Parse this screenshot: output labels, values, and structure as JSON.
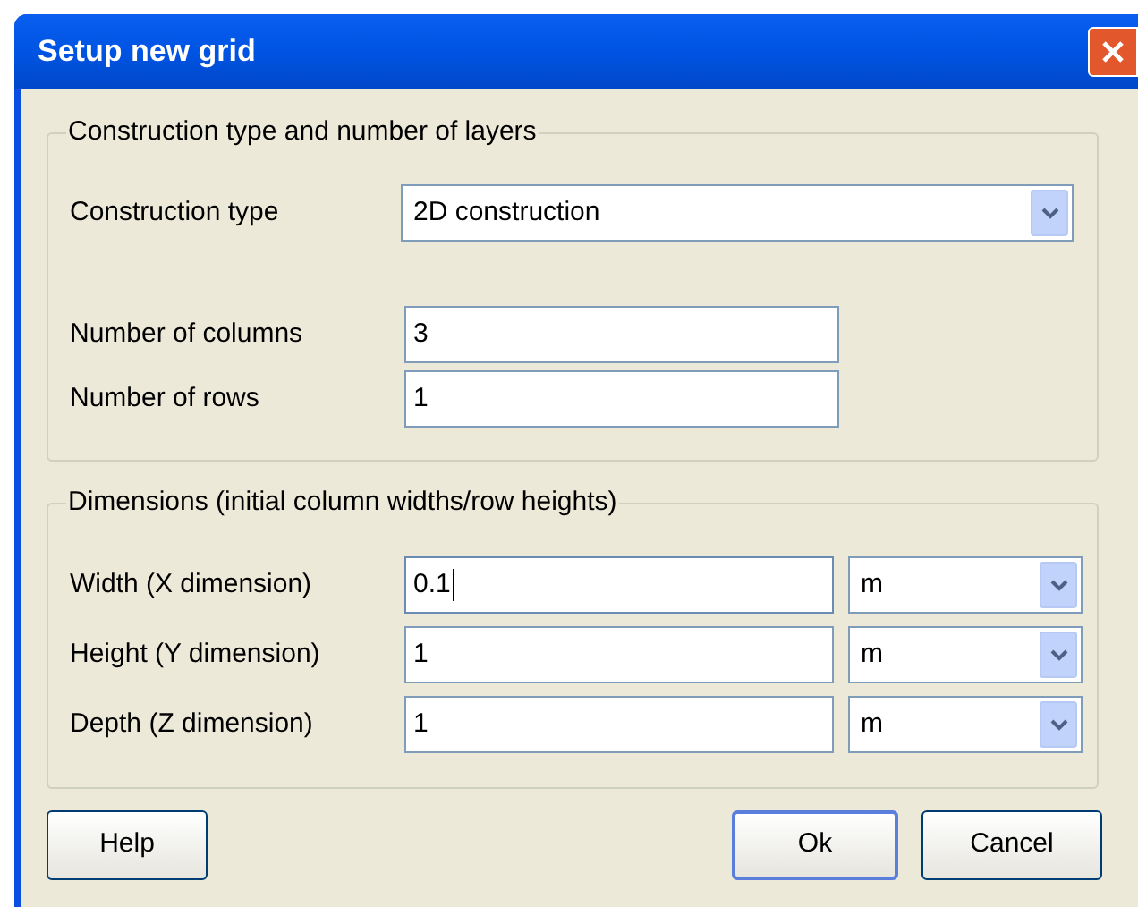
{
  "window": {
    "title": "Setup new grid"
  },
  "construction_group": {
    "legend": "Construction type and number of layers",
    "construction_type": {
      "label": "Construction type",
      "value": "2D construction"
    },
    "fields": [
      {
        "label": "Number of columns",
        "value": "3"
      },
      {
        "label": "Number of rows",
        "value": "1"
      }
    ]
  },
  "dimensions_group": {
    "legend": "Dimensions (initial column widths/row heights)",
    "rows": [
      {
        "label": "Width (X dimension)",
        "value": "0.1",
        "focused": true,
        "unit": "m"
      },
      {
        "label": "Height (Y dimension)",
        "value": "1",
        "focused": false,
        "unit": "m"
      },
      {
        "label": "Depth (Z dimension)",
        "value": "1",
        "focused": false,
        "unit": "m"
      }
    ]
  },
  "buttons": [
    {
      "label": "Help",
      "kind": "secondary",
      "default": false
    },
    {
      "label": "Ok",
      "kind": "primary",
      "default": true
    },
    {
      "label": "Cancel",
      "kind": "primary",
      "default": false
    }
  ]
}
